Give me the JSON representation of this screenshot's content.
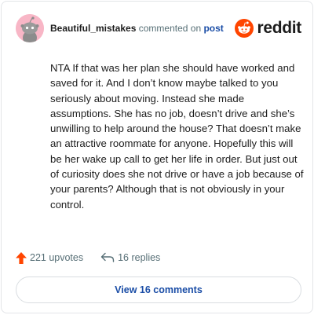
{
  "comment": {
    "username": "Beautiful_mistakes",
    "action_text": "commented on",
    "target_text": "post",
    "body": "NTA If that was her plan she should have worked and saved for it. And I don’t know maybe talked to you seriously about moving. Instead she made assumptions. She has no job, doesn’t drive and she’s unwilling to help around the house? That doesn’t make an attractive roommate for anyone. Hopefully this will be her wake up call to get her life in order. But just out of curiosity does she not drive or have a job because of your parents? Although that is not obviously in your control."
  },
  "brand": {
    "name": "reddit",
    "color": "#ff4500"
  },
  "stats": {
    "upvotes": "221 upvotes",
    "replies": "16 replies"
  },
  "button": {
    "view_label": "View 16 comments"
  },
  "colors": {
    "avatar_bg": "#f8b6c6",
    "upvote": "#ff4500",
    "link": "#1a4da6",
    "muted": "#576f76"
  }
}
